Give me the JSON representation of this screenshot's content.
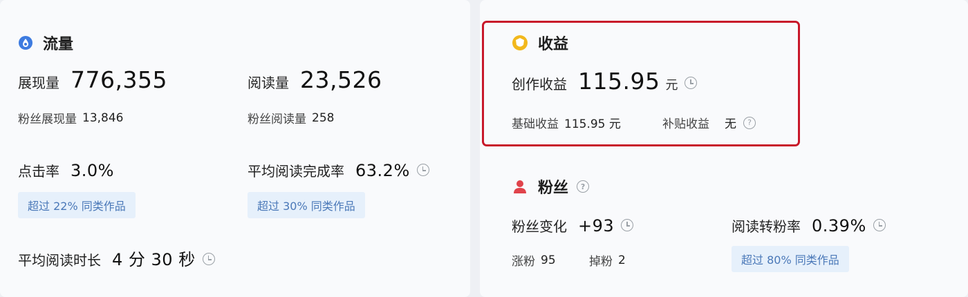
{
  "traffic": {
    "title": "流量",
    "impressions": {
      "label": "展现量",
      "value": "776,355"
    },
    "fan_impressions": {
      "label": "粉丝展现量",
      "value": "13,846"
    },
    "reads": {
      "label": "阅读量",
      "value": "23,526"
    },
    "fan_reads": {
      "label": "粉丝阅读量",
      "value": "258"
    },
    "ctr": {
      "label": "点击率",
      "value": "3.0%",
      "compare": "超过 22% 同类作品"
    },
    "completion": {
      "label": "平均阅读完成率",
      "value": "63.2%",
      "compare": "超过 30% 同类作品"
    },
    "duration": {
      "label": "平均阅读时长",
      "value": "4 分 30 秒"
    }
  },
  "earnings": {
    "title": "收益",
    "creation": {
      "label": "创作收益",
      "value": "115.95",
      "unit": "元"
    },
    "base": {
      "label": "基础收益",
      "value": "115.95 元"
    },
    "subsidy": {
      "label": "补贴收益",
      "value": "无"
    }
  },
  "fans": {
    "title": "粉丝",
    "change": {
      "label": "粉丝变化",
      "value": "+93"
    },
    "gain": {
      "label": "涨粉",
      "value": "95"
    },
    "loss": {
      "label": "掉粉",
      "value": "2"
    },
    "conversion": {
      "label": "阅读转粉率",
      "value": "0.39%",
      "compare": "超过 80% 同类作品"
    }
  },
  "colors": {
    "accent_blue": "#3d7be0",
    "gold": "#f2b81c",
    "fan_red": "#e0434b",
    "highlight": "#c8182a"
  }
}
